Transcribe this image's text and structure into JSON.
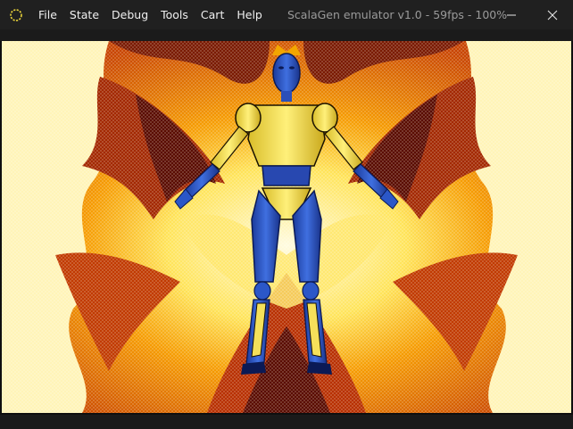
{
  "window": {
    "title": "ScalaGen emulator v1.0 - 59fps - 100%"
  },
  "menu": {
    "items": [
      {
        "label": "File"
      },
      {
        "label": "State"
      },
      {
        "label": "Debug"
      },
      {
        "label": "Tools"
      },
      {
        "label": "Cart"
      },
      {
        "label": "Help"
      }
    ]
  },
  "controls": {
    "minimize_icon": "minimize-icon",
    "close_icon": "close-icon"
  },
  "colors": {
    "titlebar": "#202020",
    "fire_dark": "#5a0c00",
    "fire_red": "#b82c00",
    "fire_orange": "#f08a00",
    "fire_yellow": "#ffd21a",
    "fire_light": "#fff6c0",
    "robot_body": "#f5e05a",
    "robot_blue": "#2b57c8"
  }
}
